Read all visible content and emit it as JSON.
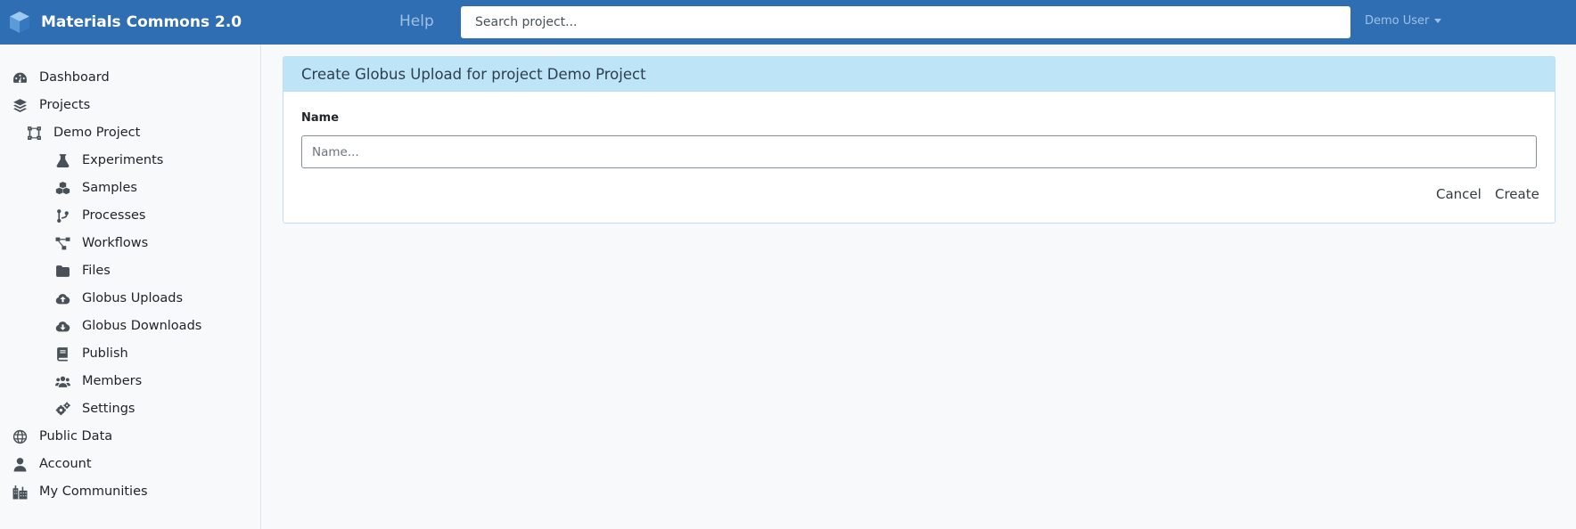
{
  "navbar": {
    "brand": "Materials Commons 2.0",
    "help": "Help",
    "search_placeholder": "Search project...",
    "user": "Demo User"
  },
  "sidebar": {
    "items": [
      {
        "label": "Dashboard",
        "icon": "dashboard-icon"
      },
      {
        "label": "Projects",
        "icon": "layers-icon"
      },
      {
        "label": "Demo Project",
        "icon": "project-shape-icon"
      },
      {
        "label": "Experiments",
        "icon": "flask-icon"
      },
      {
        "label": "Samples",
        "icon": "cubes-icon"
      },
      {
        "label": "Processes",
        "icon": "branch-icon"
      },
      {
        "label": "Workflows",
        "icon": "workflow-icon"
      },
      {
        "label": "Files",
        "icon": "folder-icon"
      },
      {
        "label": "Globus Uploads",
        "icon": "cloud-upload-icon"
      },
      {
        "label": "Globus Downloads",
        "icon": "cloud-download-icon"
      },
      {
        "label": "Publish",
        "icon": "book-icon"
      },
      {
        "label": "Members",
        "icon": "users-icon"
      },
      {
        "label": "Settings",
        "icon": "cogs-icon"
      },
      {
        "label": "Public Data",
        "icon": "globe-icon"
      },
      {
        "label": "Account",
        "icon": "user-icon"
      },
      {
        "label": "My Communities",
        "icon": "city-icon"
      }
    ]
  },
  "main": {
    "card_title": "Create Globus Upload for project Demo Project",
    "name_label": "Name",
    "name_placeholder": "Name...",
    "name_value": "",
    "cancel": "Cancel",
    "create": "Create"
  },
  "colors": {
    "navbar": "#2f6eb3",
    "card_header": "#bee5f7",
    "page_background": "#f7f9fb"
  }
}
